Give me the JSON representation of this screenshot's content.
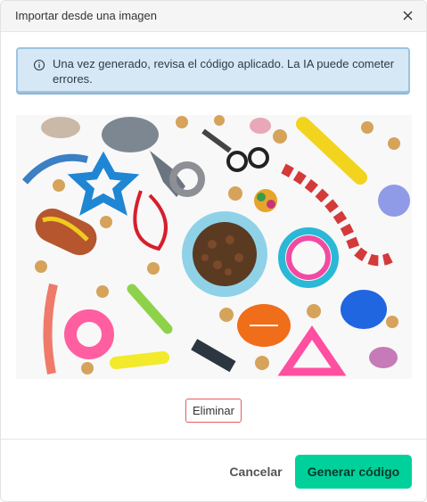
{
  "dialog": {
    "title": "Importar desde una imagen",
    "close_icon": "close-icon"
  },
  "alert": {
    "icon": "info-icon",
    "message": "Una vez generado, revisa el código aplicado. La IA puede cometer errores."
  },
  "image": {
    "subject": "pet-toys-photo"
  },
  "actions": {
    "delete_label": "Eliminar",
    "cancel_label": "Cancelar",
    "generate_label": "Generar código"
  },
  "colors": {
    "primary": "#00d19b",
    "danger_border": "#e55b5b",
    "alert_bg": "#d6e8f6",
    "alert_border": "#9cc4e0"
  }
}
